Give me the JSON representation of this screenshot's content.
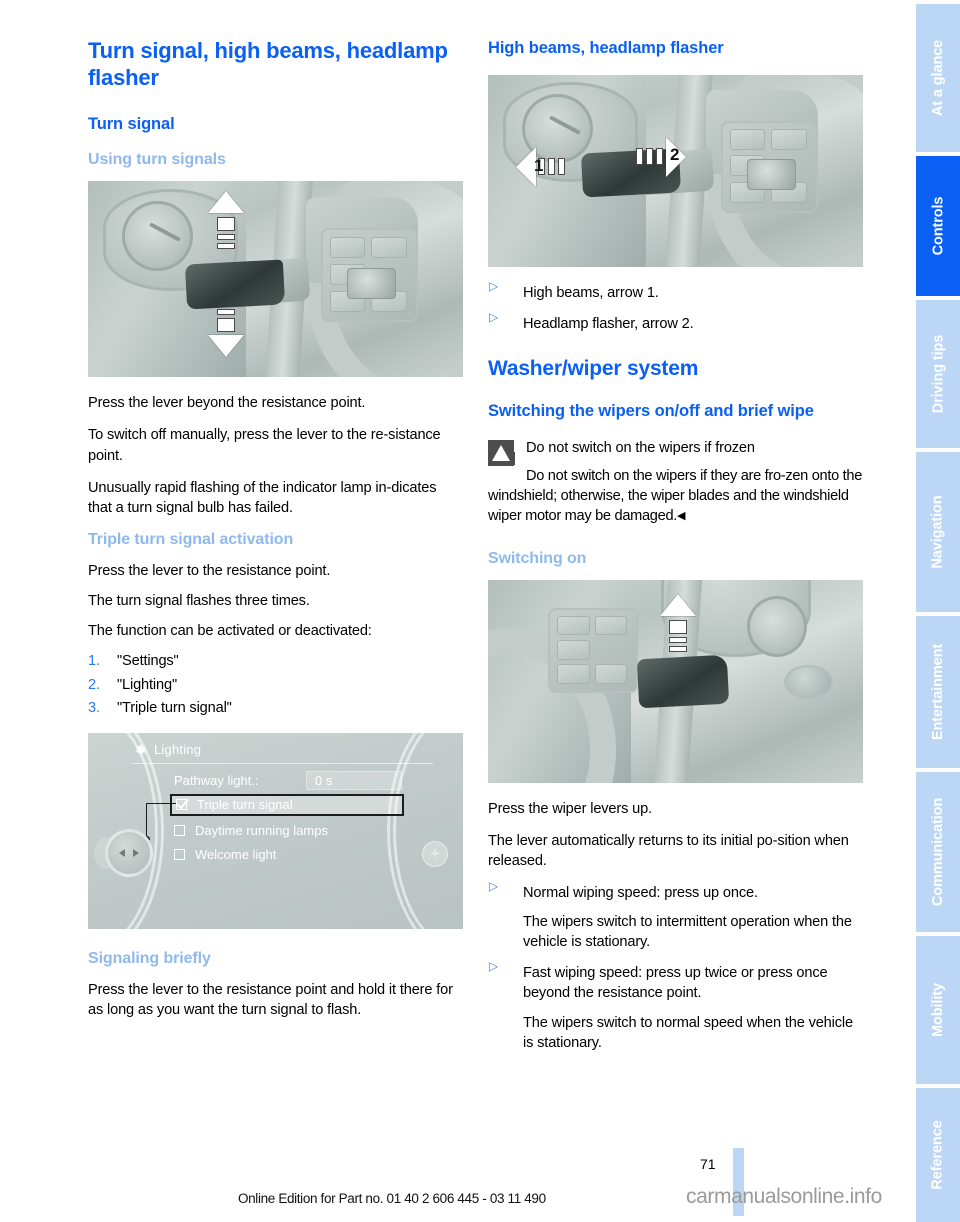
{
  "document": {
    "page_number": "71",
    "footer_text": "Online Edition for Part no. 01 40 2 606 445 - 03 11 490",
    "watermark": "carmanualsonline.info"
  },
  "left_column": {
    "title": "Turn signal, high beams, headlamp flasher",
    "section_turn_signal": "Turn signal",
    "subsection_using": "Using turn signals",
    "para_1": "Press the lever beyond the resistance point.",
    "para_2": "To switch off manually, press the lever to the re-sistance point.",
    "para_3": "Unusually rapid flashing of the indicator lamp in-dicates that a turn signal bulb has failed.",
    "subsection_triple": "Triple turn signal activation",
    "para_4": "Press the lever to the resistance point.",
    "para_5": "The turn signal flashes three times.",
    "para_6": "The function can be activated or deactivated:",
    "steps": [
      {
        "num": "1.",
        "label": "\"Settings\""
      },
      {
        "num": "2.",
        "label": "\"Lighting\""
      },
      {
        "num": "3.",
        "label": "\"Triple turn signal\""
      }
    ],
    "subsection_signaling": "Signaling briefly",
    "para_7": "Press the lever to the resistance point and hold it there for as long as you want the turn signal to flash."
  },
  "idrive_screen": {
    "icon": "gear-icon",
    "title": "Lighting",
    "row_label": "Pathway light.:",
    "row_value": "0 s",
    "items": [
      {
        "label": "Triple turn signal",
        "checked": true,
        "selected": true
      },
      {
        "label": "Daytime running lamps",
        "checked": false,
        "selected": false
      },
      {
        "label": "Welcome light",
        "checked": false,
        "selected": false
      }
    ],
    "plus_label": "+"
  },
  "right_column": {
    "subsection_high_beams": "High beams, headlamp flasher",
    "photo_arrow_1": "1",
    "photo_arrow_2": "2",
    "bullets_high_beams": [
      "High beams, arrow 1.",
      "Headlamp flasher, arrow 2."
    ],
    "section_washer": "Washer/wiper system",
    "subsection_switching": "Switching the wipers on/off and brief wipe",
    "warning": {
      "icon": "warning-triangle-icon",
      "title": "Do not switch on the wipers if frozen",
      "text": "Do not switch on the wipers if they are fro-zen onto the windshield; otherwise, the wiper blades and the windshield wiper motor may be damaged.",
      "end_marker": "◀"
    },
    "subsection_switching_on": "Switching on",
    "para_1": "Press the wiper levers up.",
    "para_2": "The lever automatically returns to its initial po-sition when released.",
    "bullets_speed": [
      {
        "main": "Normal wiping speed: press up once.",
        "sub": "The wipers switch to intermittent operation when the vehicle is stationary."
      },
      {
        "main": "Fast wiping speed: press up twice or press once beyond the resistance point.",
        "sub": "The wipers switch to normal speed when the vehicle is stationary."
      }
    ]
  },
  "sidebar": {
    "tabs": [
      {
        "label": "At a glance",
        "active": false
      },
      {
        "label": "Controls",
        "active": true
      },
      {
        "label": "Driving tips",
        "active": false
      },
      {
        "label": "Navigation",
        "active": false
      },
      {
        "label": "Entertainment",
        "active": false
      },
      {
        "label": "Communication",
        "active": false
      },
      {
        "label": "Mobility",
        "active": false
      },
      {
        "label": "Reference",
        "active": false
      }
    ]
  },
  "colors": {
    "heading_blue": "#0a5ff5",
    "subheading_light_blue": "#8fb9ec",
    "tab_inactive": "#bcd6f5",
    "tab_active": "#0a5ff5"
  }
}
